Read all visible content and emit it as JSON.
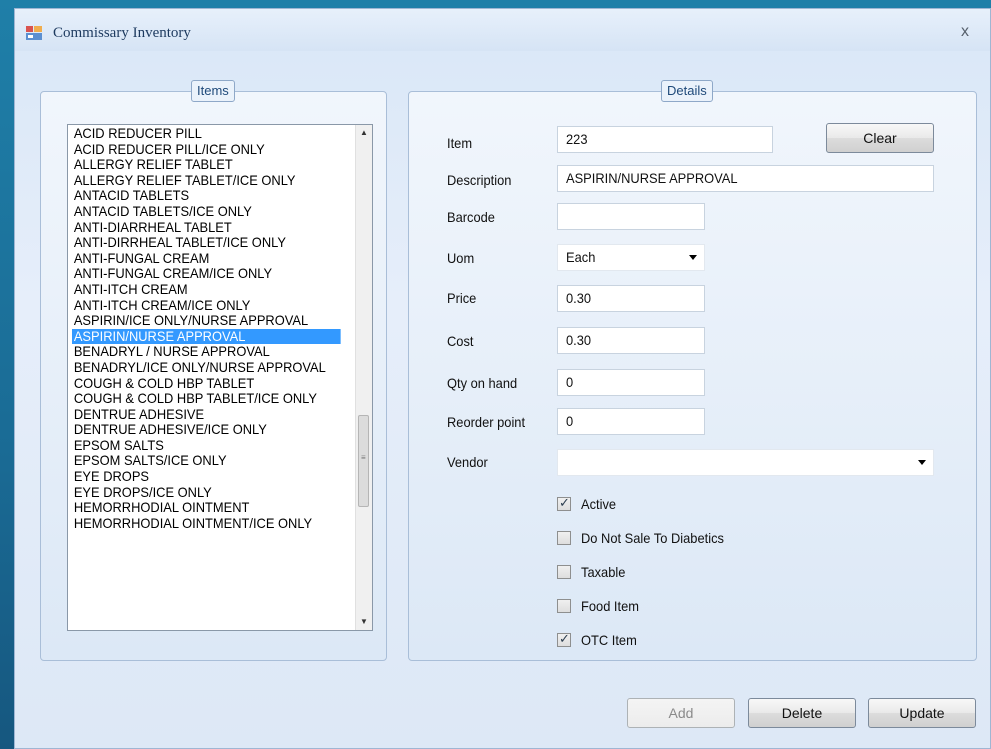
{
  "window": {
    "title": "Commissary Inventory",
    "close_glyph": "x",
    "icon": "app-window-icon"
  },
  "items_group": {
    "legend": "Items",
    "list": [
      "ACID REDUCER PILL",
      "ACID REDUCER PILL/ICE ONLY",
      "ALLERGY RELIEF TABLET",
      "ALLERGY RELIEF TABLET/ICE ONLY",
      "ANTACID TABLETS",
      "ANTACID TABLETS/ICE ONLY",
      "ANTI-DIARRHEAL TABLET",
      "ANTI-DIRRHEAL TABLET/ICE ONLY",
      "ANTI-FUNGAL CREAM",
      "ANTI-FUNGAL CREAM/ICE ONLY",
      "ANTI-ITCH CREAM",
      "ANTI-ITCH CREAM/ICE ONLY",
      "ASPIRIN/ICE ONLY/NURSE APPROVAL",
      "ASPIRIN/NURSE APPROVAL",
      "BENADRYL / NURSE APPROVAL",
      "BENADRYL/ICE ONLY/NURSE APPROVAL",
      "COUGH & COLD HBP TABLET",
      "COUGH & COLD HBP TABLET/ICE ONLY",
      "DENTRUE ADHESIVE",
      "DENTRUE ADHESIVE/ICE ONLY",
      "EPSOM SALTS",
      "EPSOM SALTS/ICE ONLY",
      "EYE DROPS",
      "EYE DROPS/ICE ONLY",
      "HEMORRHODIAL OINTMENT",
      "HEMORRHODIAL OINTMENT/ICE ONLY"
    ],
    "selected_index": 13
  },
  "details_group": {
    "legend": "Details",
    "fields": {
      "item": {
        "label": "Item",
        "value": "223"
      },
      "description": {
        "label": "Description",
        "value": "ASPIRIN/NURSE APPROVAL"
      },
      "barcode": {
        "label": "Barcode",
        "value": ""
      },
      "uom": {
        "label": "Uom",
        "value": "Each"
      },
      "price": {
        "label": "Price",
        "value": "0.30"
      },
      "cost": {
        "label": "Cost",
        "value": "0.30"
      },
      "qty_on_hand": {
        "label": "Qty on hand",
        "value": "0"
      },
      "reorder_point": {
        "label": "Reorder point",
        "value": "0"
      },
      "vendor": {
        "label": "Vendor",
        "value": ""
      }
    },
    "clear_label": "Clear",
    "checkboxes": [
      {
        "label": "Active",
        "checked": true
      },
      {
        "label": "Do Not Sale To Diabetics",
        "checked": false
      },
      {
        "label": "Taxable",
        "checked": false
      },
      {
        "label": "Food Item",
        "checked": false
      },
      {
        "label": "OTC Item",
        "checked": true
      }
    ]
  },
  "footer": {
    "add_label": "Add",
    "delete_label": "Delete",
    "update_label": "Update"
  },
  "colors": {
    "selection": "#3399ff",
    "desktop": "#1a6b95"
  }
}
